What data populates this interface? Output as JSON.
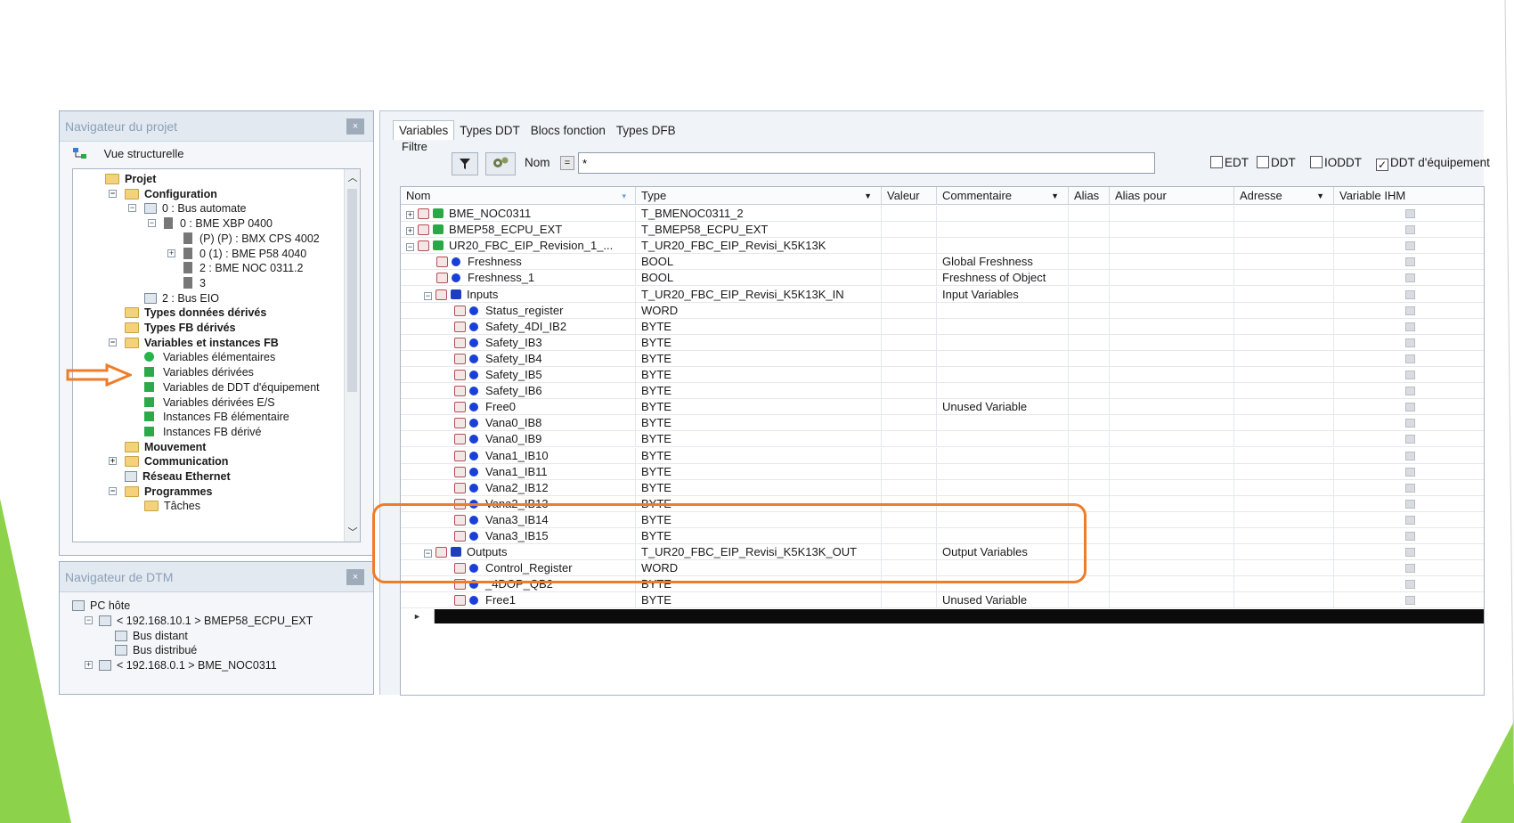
{
  "project_navigator": {
    "title": "Navigateur du projet",
    "close_label": "×",
    "view_label": "Vue structurelle",
    "tree": [
      {
        "label": "Projet",
        "bold": true,
        "depth": 0,
        "icon": "folder-icon"
      },
      {
        "label": "Configuration",
        "bold": true,
        "depth": 1,
        "icon": "folder-icon",
        "expander": "−"
      },
      {
        "label": "0 : Bus automate",
        "depth": 2,
        "icon": "network-icon",
        "expander": "−"
      },
      {
        "label": "0 : BME XBP 0400",
        "depth": 3,
        "icon": "rack-icon",
        "expander": "−"
      },
      {
        "label": "(P) (P) : BMX CPS 4002",
        "depth": 4,
        "icon": "module-icon"
      },
      {
        "label": "0 (1) : BME P58 4040",
        "depth": 4,
        "icon": "module-icon",
        "expander": "+"
      },
      {
        "label": "2 : BME NOC 0311.2",
        "depth": 4,
        "icon": "module-icon"
      },
      {
        "label": "3",
        "depth": 4,
        "icon": "slot-icon"
      },
      {
        "label": "2 : Bus EIO",
        "depth": 2,
        "icon": "network-icon"
      },
      {
        "label": "Types données dérivés",
        "bold": true,
        "depth": 1,
        "icon": "folder-icon"
      },
      {
        "label": "Types FB dérivés",
        "bold": true,
        "depth": 1,
        "icon": "folder-icon"
      },
      {
        "label": "Variables et instances FB",
        "bold": true,
        "depth": 1,
        "icon": "folder-icon",
        "expander": "−"
      },
      {
        "label": "Variables élémentaires",
        "depth": 2,
        "icon": "green-dot-icon"
      },
      {
        "label": "Variables dérivées",
        "depth": 2,
        "icon": "green-square-icon"
      },
      {
        "label": "Variables de DDT d'équipement",
        "depth": 2,
        "icon": "green-square-icon"
      },
      {
        "label": "Variables dérivées E/S",
        "depth": 2,
        "icon": "green-square-icon"
      },
      {
        "label": "Instances FB élémentaire",
        "depth": 2,
        "icon": "green-square-icon"
      },
      {
        "label": "Instances FB dérivé",
        "depth": 2,
        "icon": "green-square-icon"
      },
      {
        "label": "Mouvement",
        "bold": true,
        "depth": 1,
        "icon": "folder-icon"
      },
      {
        "label": "Communication",
        "bold": true,
        "depth": 1,
        "icon": "folder-icon",
        "expander": "+"
      },
      {
        "label": "Réseau Ethernet",
        "bold": true,
        "depth": 1,
        "icon": "network-icon"
      },
      {
        "label": "Programmes",
        "bold": true,
        "depth": 1,
        "icon": "folder-icon",
        "expander": "−"
      },
      {
        "label": "Tâches",
        "depth": 2,
        "icon": "folder-icon"
      }
    ]
  },
  "dtm_navigator": {
    "title": "Navigateur de DTM",
    "close_label": "×",
    "tree": [
      {
        "label": "PC hôte",
        "depth": 0,
        "icon": "pc-icon"
      },
      {
        "label": "< 192.168.10.1 > BMEP58_ECPU_EXT",
        "depth": 1,
        "icon": "device-icon",
        "expander": "−"
      },
      {
        "label": "Bus distant",
        "depth": 2,
        "icon": "network-icon"
      },
      {
        "label": "Bus distribué",
        "depth": 2,
        "icon": "network-icon"
      },
      {
        "label": "< 192.168.0.1 > BME_NOC0311",
        "depth": 1,
        "icon": "device-icon",
        "expander": "+"
      }
    ]
  },
  "tabs": [
    "Variables",
    "Types DDT",
    "Blocs fonction",
    "Types DFB"
  ],
  "filter": {
    "label": "Filtre",
    "nom_label": "Nom",
    "eq_label": "=",
    "value": "*",
    "checks": [
      {
        "label": "EDT",
        "checked": false
      },
      {
        "label": "DDT",
        "checked": false
      },
      {
        "label": "IODDT",
        "checked": false
      },
      {
        "label": "DDT d'équipement",
        "checked": true
      }
    ]
  },
  "columns": [
    "Nom",
    "Type",
    "Valeur",
    "Commentaire",
    "Alias",
    "Alias pour",
    "Adresse",
    "Variable IHM"
  ],
  "rows": [
    {
      "name": "BME_NOC0311",
      "type": "T_BMENOC0311_2",
      "comment": "",
      "indent": 0,
      "icon": "green",
      "exp": "+"
    },
    {
      "name": "BMEP58_ECPU_EXT",
      "type": "T_BMEP58_ECPU_EXT",
      "comment": "",
      "indent": 0,
      "icon": "green",
      "exp": "+"
    },
    {
      "name": "UR20_FBC_EIP_Revision_1_...",
      "type": "T_UR20_FBC_EIP_Revisi_K5K13K",
      "comment": "",
      "indent": 0,
      "icon": "green",
      "exp": "−"
    },
    {
      "name": "Freshness",
      "type": "BOOL",
      "comment": "Global Freshness",
      "indent": 1,
      "icon": "dot"
    },
    {
      "name": "Freshness_1",
      "type": "BOOL",
      "comment": "Freshness of Object",
      "indent": 1,
      "icon": "dot"
    },
    {
      "name": "Inputs",
      "type": "T_UR20_FBC_EIP_Revisi_K5K13K_IN",
      "comment": "Input Variables",
      "indent": 1,
      "icon": "blue",
      "exp": "−"
    },
    {
      "name": "Status_register",
      "type": "WORD",
      "comment": "",
      "indent": 2,
      "icon": "dot"
    },
    {
      "name": "Safety_4DI_IB2",
      "type": "BYTE",
      "comment": "",
      "indent": 2,
      "icon": "dot"
    },
    {
      "name": "Safety_IB3",
      "type": "BYTE",
      "comment": "",
      "indent": 2,
      "icon": "dot"
    },
    {
      "name": "Safety_IB4",
      "type": "BYTE",
      "comment": "",
      "indent": 2,
      "icon": "dot"
    },
    {
      "name": "Safety_IB5",
      "type": "BYTE",
      "comment": "",
      "indent": 2,
      "icon": "dot"
    },
    {
      "name": "Safety_IB6",
      "type": "BYTE",
      "comment": "",
      "indent": 2,
      "icon": "dot"
    },
    {
      "name": "Free0",
      "type": "BYTE",
      "comment": "Unused Variable",
      "indent": 2,
      "icon": "dot"
    },
    {
      "name": "Vana0_IB8",
      "type": "BYTE",
      "comment": "",
      "indent": 2,
      "icon": "dot"
    },
    {
      "name": "Vana0_IB9",
      "type": "BYTE",
      "comment": "",
      "indent": 2,
      "icon": "dot"
    },
    {
      "name": "Vana1_IB10",
      "type": "BYTE",
      "comment": "",
      "indent": 2,
      "icon": "dot"
    },
    {
      "name": "Vana1_IB11",
      "type": "BYTE",
      "comment": "",
      "indent": 2,
      "icon": "dot"
    },
    {
      "name": "Vana2_IB12",
      "type": "BYTE",
      "comment": "",
      "indent": 2,
      "icon": "dot"
    },
    {
      "name": "Vana2_IB13",
      "type": "BYTE",
      "comment": "",
      "indent": 2,
      "icon": "dot"
    },
    {
      "name": "Vana3_IB14",
      "type": "BYTE",
      "comment": "",
      "indent": 2,
      "icon": "dot"
    },
    {
      "name": "Vana3_IB15",
      "type": "BYTE",
      "comment": "",
      "indent": 2,
      "icon": "dot"
    },
    {
      "name": "Outputs",
      "type": "T_UR20_FBC_EIP_Revisi_K5K13K_OUT",
      "comment": "Output Variables",
      "indent": 1,
      "icon": "blue",
      "exp": "−"
    },
    {
      "name": "Control_Register",
      "type": "WORD",
      "comment": "",
      "indent": 2,
      "icon": "dot"
    },
    {
      "name": "_4DOP_QB2",
      "type": "BYTE",
      "comment": "",
      "indent": 2,
      "icon": "dot"
    },
    {
      "name": "Free1",
      "type": "BYTE",
      "comment": "Unused Variable",
      "indent": 2,
      "icon": "dot"
    }
  ],
  "colors": {
    "accent_orange": "#ee7d2a",
    "deco_green": "#8cd24a",
    "variable_blue": "#1a3fd8",
    "ddt_green": "#2aa845"
  }
}
